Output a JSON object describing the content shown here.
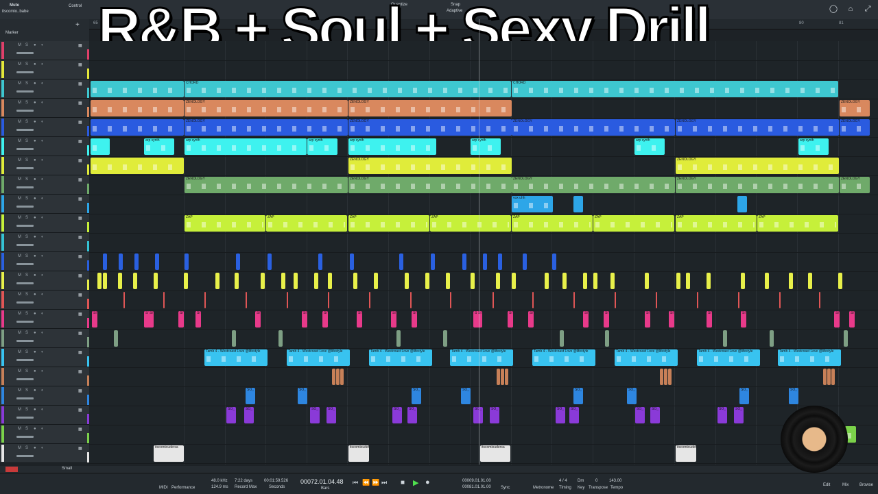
{
  "headline": "R&B + Soul + Sexy Drill",
  "topbar": {
    "mute_label": "Mute",
    "file_label": "itscomio..babe",
    "control_label": "Control",
    "quantize_label": "Quantize",
    "snap_label": "Snap",
    "snap_value": "Adaptive",
    "ruler_left_num": "65",
    "ruler_80": "80",
    "ruler_81": "81"
  },
  "header": {
    "marker_label": "Marker"
  },
  "tracks": [
    {
      "num": "2",
      "name": "CHORD",
      "color": "#e0406a"
    },
    {
      "num": "4",
      "name": "string",
      "color": "#e4e83a"
    },
    {
      "num": "5",
      "name": "sine lead",
      "color": "#3ec7d0"
    },
    {
      "num": "7",
      "name": "piano",
      "color": "#d9885e"
    },
    {
      "num": "8",
      "name": "PAD",
      "color": "#2a5be0"
    },
    {
      "num": "9",
      "name": "arp synth",
      "color": "#3ef2ef"
    },
    {
      "num": "10",
      "name": "BELL",
      "color": "#e0ec3a"
    },
    {
      "num": "11",
      "name": "MOOG BASS",
      "color": "#6faa6a"
    },
    {
      "num": "12",
      "name": "vox uhh",
      "color": "#2da6e8"
    },
    {
      "num": "13",
      "name": "ZAP",
      "color": "#c6f03a"
    },
    {
      "num": "14",
      "name": "laser zap",
      "color": "#35c3d4"
    },
    {
      "num": "15",
      "name": "STOMP",
      "color": "#2a60e0"
    },
    {
      "num": "16",
      "name": "KICK",
      "color": "#e8f04a"
    },
    {
      "num": "17",
      "name": "SNARE",
      "color": "#e05656"
    },
    {
      "num": "18",
      "name": "SNARE extra",
      "color": "#e83a8a"
    },
    {
      "num": "19",
      "name": "perc low",
      "color": "#7e9f84"
    },
    {
      "num": "20",
      "name": "Tamb",
      "color": "#38c3f0"
    },
    {
      "num": "21",
      "name": "808toms",
      "color": "#c78058"
    },
    {
      "num": "22",
      "name": "hat open",
      "color": "#2e86e0"
    },
    {
      "num": "23",
      "name": "cowbell D",
      "color": "#8a3ad8"
    },
    {
      "num": "24",
      "name": "fx west",
      "color": "#7bd24a"
    },
    {
      "num": "25",
      "name": "itscomio..babe",
      "color": "#e6e6e6"
    }
  ],
  "clip_labels": {
    "chord": "CHORD",
    "zenology": "ZENOLOGY",
    "arp": "arp synth",
    "vox": "vox uhh",
    "zap": "ZAP",
    "tamb": "Tamb 4 - Westcoast Love @lifestyle",
    "so": "SO_",
    "si": "SI",
    "itscomio": "itscomioudersa"
  },
  "transport": {
    "midi": "MIDI",
    "performance": "Performance",
    "sample_rate": "48.0 kHz",
    "latency": "124.9 ms",
    "record_time": "7:22 days",
    "record_max": "Record Max",
    "seconds_val": "00:01:59.526",
    "seconds_label": "Seconds",
    "position": "00072.01.04.48",
    "bars_label": "Bars",
    "loop_start": "00009.01.01.00",
    "loop_end": "00081.01.01.00",
    "sync": "Sync",
    "metronome": "Metronome",
    "timing_val": "4 / 4",
    "timing": "Timing",
    "key_val": "Dm",
    "key": "Key",
    "transpose_val": "0",
    "transpose": "Transpose",
    "tempo_val": "143.00",
    "tempo": "Tempo",
    "edit": "Edit",
    "mix": "Mix",
    "browse": "Browse",
    "small": "Small"
  }
}
